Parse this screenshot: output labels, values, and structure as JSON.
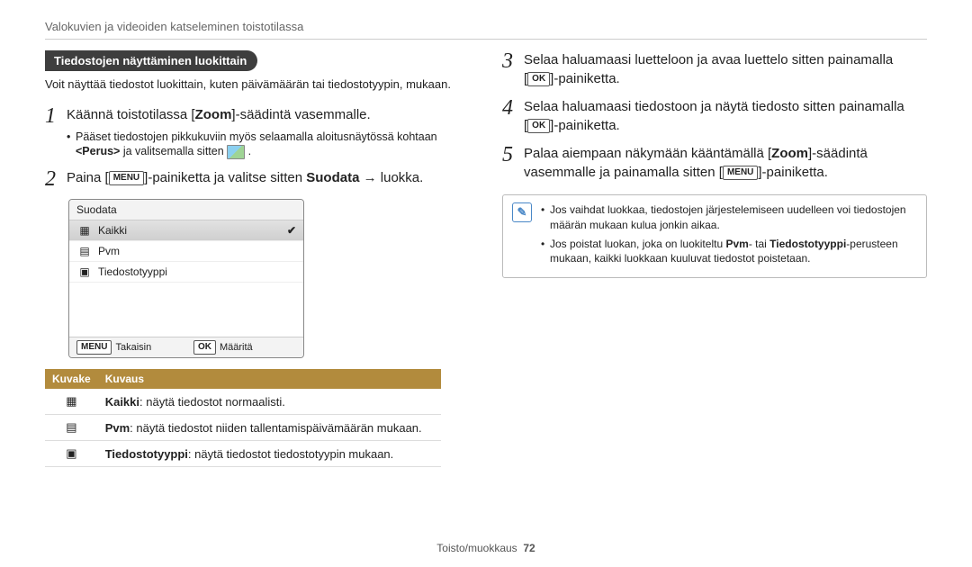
{
  "header": "Valokuvien ja videoiden katseleminen toistotilassa",
  "left": {
    "section_title": "Tiedostojen näyttäminen luokittain",
    "intro": "Voit näyttää tiedostot luokittain, kuten päivämäärän tai tiedostotyypin, mukaan.",
    "step1_pre": "Käännä toistotilassa [",
    "step1_bold": "Zoom",
    "step1_post": "]-säädintä vasemmalle.",
    "step1_sub_pre": "Pääset tiedostojen pikkukuviin myös selaamalla aloitusnäytössä kohtaan ",
    "step1_sub_bold": "<Perus>",
    "step1_sub_post": " ja valitsemalla sitten ",
    "step2_pre": "Paina [",
    "step2_key": "MENU",
    "step2_mid": "]-painiketta ja valitse sitten ",
    "step2_bold": "Suodata",
    "step2_post": " → luokka.",
    "menu": {
      "title": "Suodata",
      "items": [
        {
          "label": "Kaikki",
          "selected": true
        },
        {
          "label": "Pvm",
          "selected": false
        },
        {
          "label": "Tiedostotyyppi",
          "selected": false
        }
      ],
      "footer_left_key": "MENU",
      "footer_left": "Takaisin",
      "footer_right_key": "OK",
      "footer_right": "Määritä"
    },
    "table": {
      "headers": [
        "Kuvake",
        "Kuvaus"
      ],
      "rows": [
        {
          "bold": "Kaikki",
          "rest": ": näytä tiedostot normaalisti."
        },
        {
          "bold": "Pvm",
          "rest": ": näytä tiedostot niiden tallentamispäivämäärän mukaan."
        },
        {
          "bold": "Tiedostotyyppi",
          "rest": ": näytä tiedostot tiedostotyypin mukaan."
        }
      ]
    }
  },
  "right": {
    "step3_line1": "Selaa haluamaasi luetteloon ja avaa luettelo sitten painamalla",
    "step3_line2_pre": "[",
    "step3_key": "OK",
    "step3_line2_post": "]-painiketta.",
    "step4_line1": "Selaa haluamaasi tiedostoon ja näytä tiedosto sitten painamalla",
    "step4_line2_pre": "[",
    "step4_key": "OK",
    "step4_line2_post": "]-painiketta.",
    "step5_line1_pre": "Palaa aiempaan näkymään kääntämällä [",
    "step5_bold1": "Zoom",
    "step5_line1_post": "]-säädintä",
    "step5_line2_pre": "vasemmalle ja painamalla sitten [",
    "step5_key": "MENU",
    "step5_line2_post": "]-painiketta.",
    "note1": "Jos vaihdat luokkaa, tiedostojen järjestelemiseen uudelleen voi tiedostojen määrän mukaan kulua jonkin aikaa.",
    "note2_pre": "Jos poistat luokan, joka on luokiteltu ",
    "note2_b1": "Pvm",
    "note2_mid": "- tai ",
    "note2_b2": "Tiedostotyyppi",
    "note2_post": "-perusteen mukaan, kaikki luokkaan kuuluvat tiedostot poistetaan."
  },
  "footer": {
    "text": "Toisto/muokkaus",
    "page": "72"
  }
}
